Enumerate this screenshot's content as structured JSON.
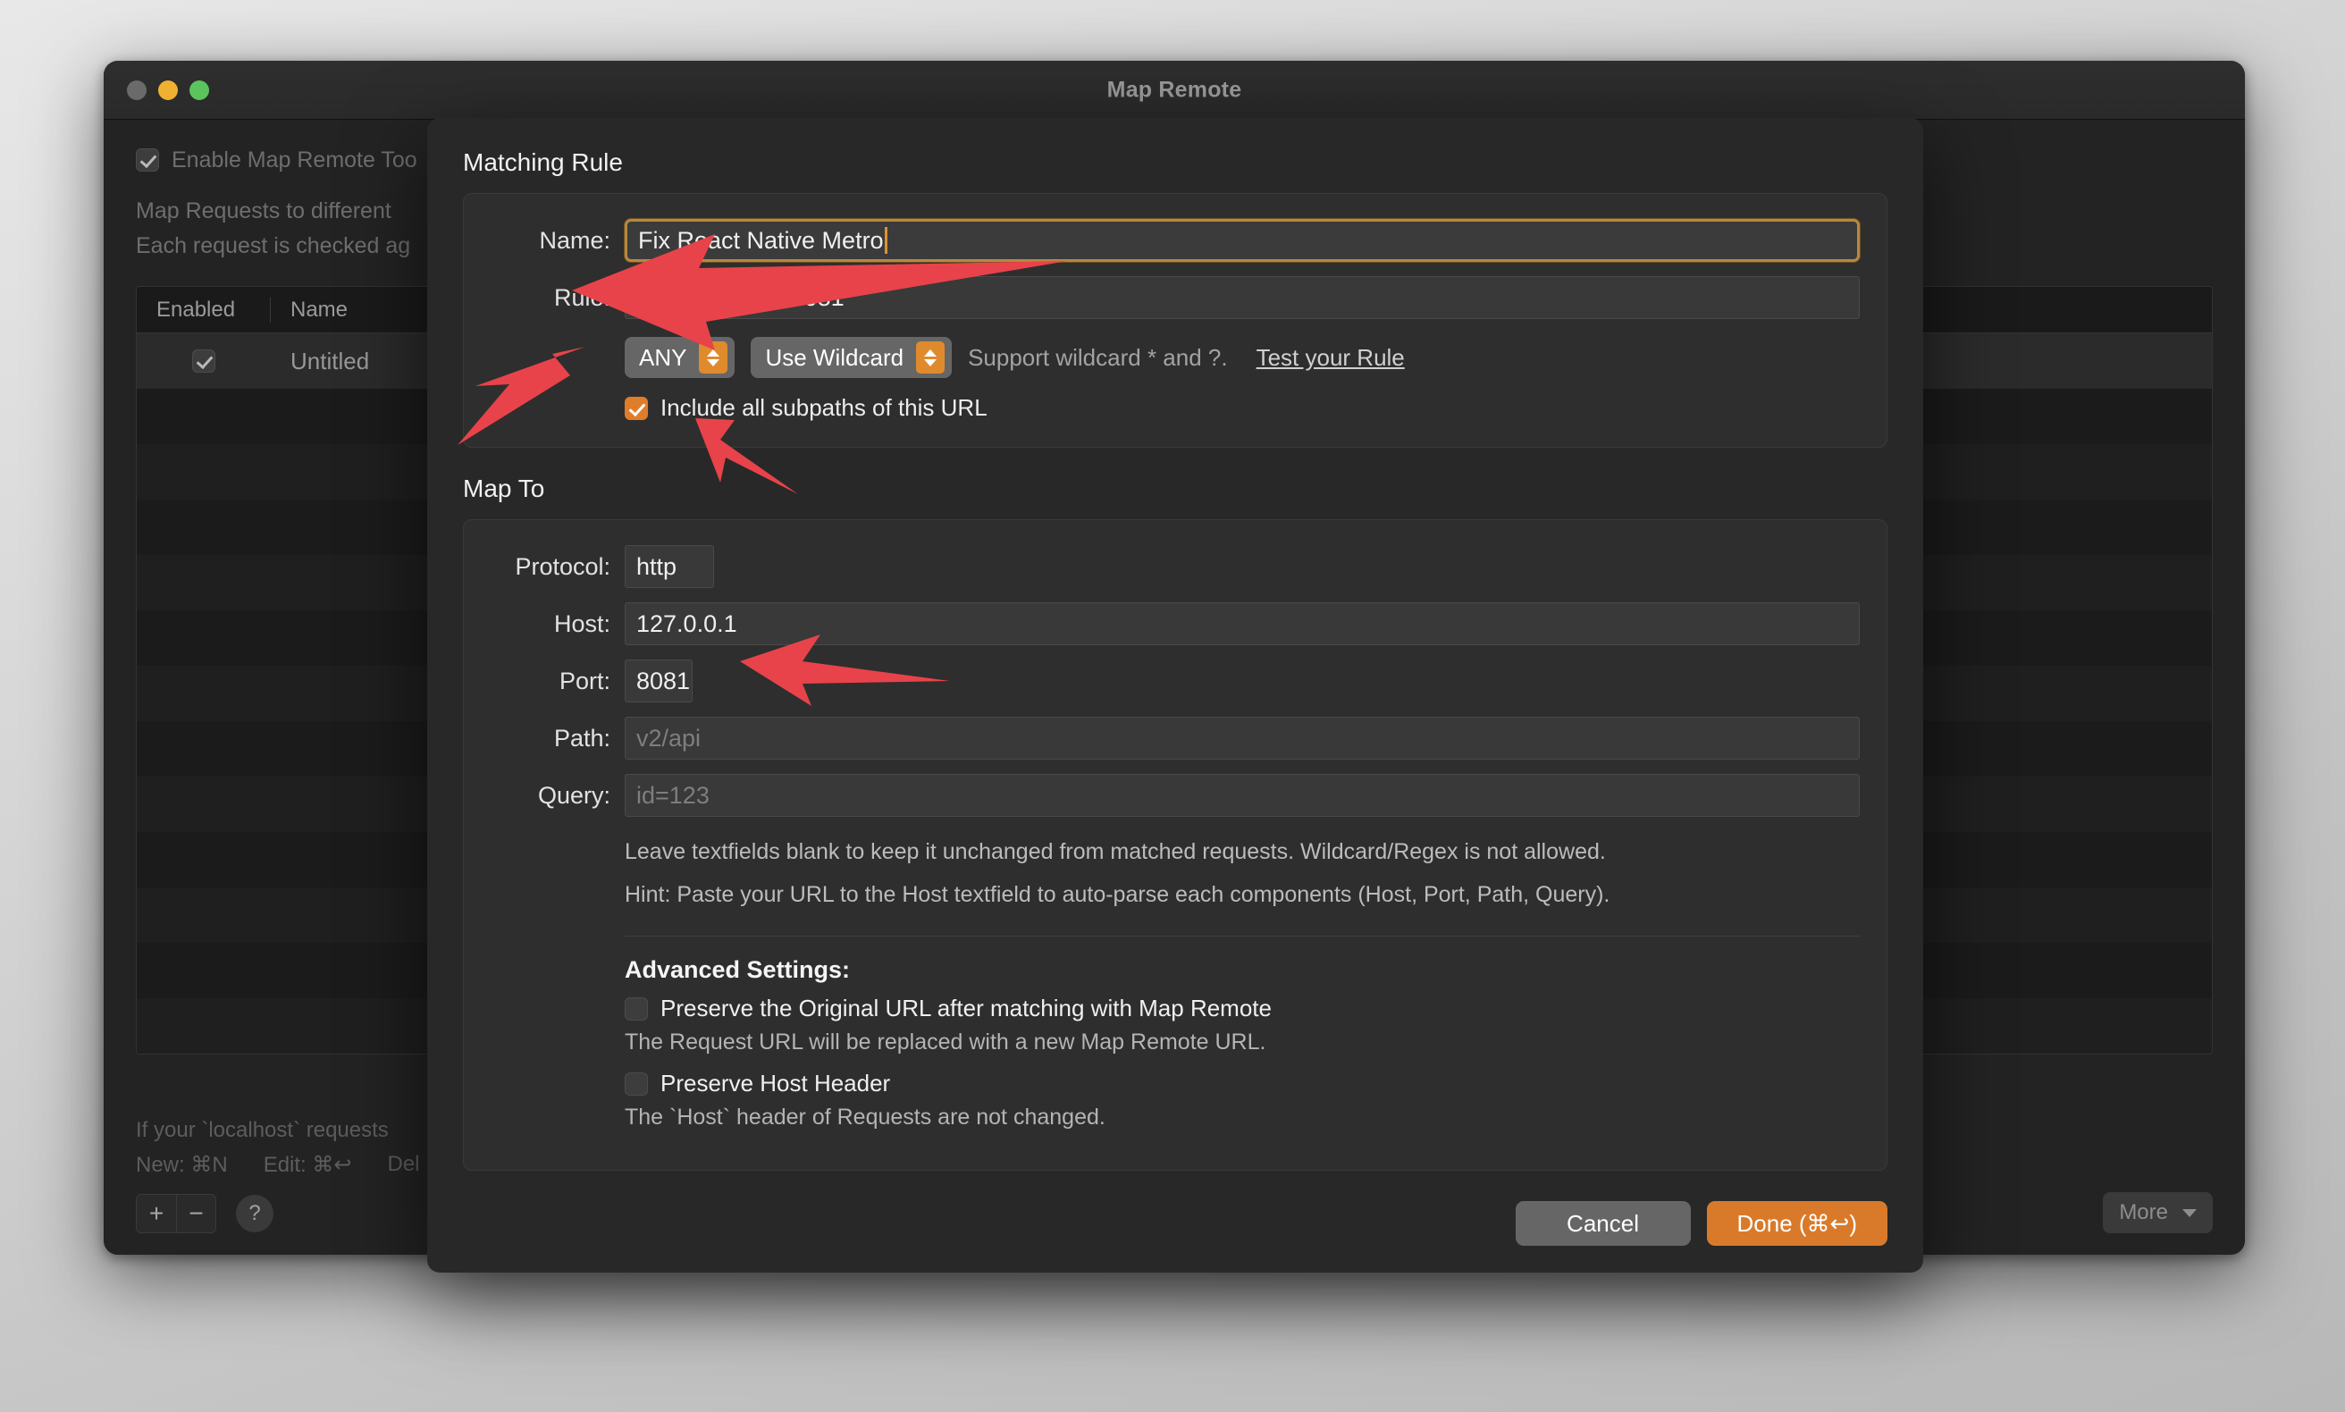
{
  "window": {
    "title": "Map Remote",
    "traffic_lights": [
      "close",
      "minimize",
      "zoom"
    ],
    "enable_checkbox_label": "Enable Map Remote Too",
    "desc_line_1": "Map Requests to different",
    "desc_line_2": "Each request is checked ag",
    "table": {
      "headers": [
        "Enabled",
        "Name"
      ],
      "rows": [
        {
          "enabled": true,
          "name": "Untitled"
        }
      ]
    },
    "footer": {
      "localhost_note": "If your `localhost` requests",
      "shortcut_new": "New: ⌘N",
      "shortcut_edit": "Edit: ⌘↩",
      "shortcut_delete": "Del",
      "add_button": "+",
      "remove_button": "−",
      "help_button": "?",
      "more_button": "More"
    }
  },
  "sheet": {
    "matching_rule": {
      "section_title": "Matching Rule",
      "name_label": "Name:",
      "name_value": "Fix React Native Metro",
      "rule_label": "Rule:",
      "rule_value": "http://10.0.2.2:8081",
      "method_select": "ANY",
      "wildcard_select": "Use Wildcard",
      "wildcard_hint": "Support wildcard * and ?.",
      "test_rule_link": "Test your Rule",
      "subpaths_checkbox_label": "Include all subpaths of this URL",
      "subpaths_checked": true
    },
    "map_to": {
      "section_title": "Map To",
      "protocol_label": "Protocol:",
      "protocol_value": "http",
      "host_label": "Host:",
      "host_value": "127.0.0.1",
      "port_label": "Port:",
      "port_value": "8081",
      "path_label": "Path:",
      "path_placeholder": "v2/api",
      "query_label": "Query:",
      "query_placeholder": "id=123",
      "note_1": "Leave textfields blank to keep it unchanged from matched requests. Wildcard/Regex is not allowed.",
      "note_2": "Hint: Paste your URL to the Host textfield to auto-parse each components (Host, Port, Path, Query).",
      "advanced_title": "Advanced Settings:",
      "preserve_url_label": "Preserve the Original URL after matching with Map Remote",
      "preserve_url_checked": false,
      "preserve_url_note": "The Request URL will be replaced with a new Map Remote URL.",
      "preserve_host_label": "Preserve Host Header",
      "preserve_host_checked": false,
      "preserve_host_note": "The `Host` header of Requests are not changed."
    },
    "buttons": {
      "cancel": "Cancel",
      "done": "Done (⌘↩)"
    }
  },
  "colors": {
    "accent_orange": "#d97a2b",
    "focus_ring": "#b8873f",
    "annotation_red": "#e8434a",
    "window_bg": "#232323",
    "sheet_bg": "#282828"
  },
  "annotations": {
    "count": 3,
    "targets": [
      "rule-field",
      "method-select",
      "subpaths-checkbox",
      "port-field"
    ]
  }
}
